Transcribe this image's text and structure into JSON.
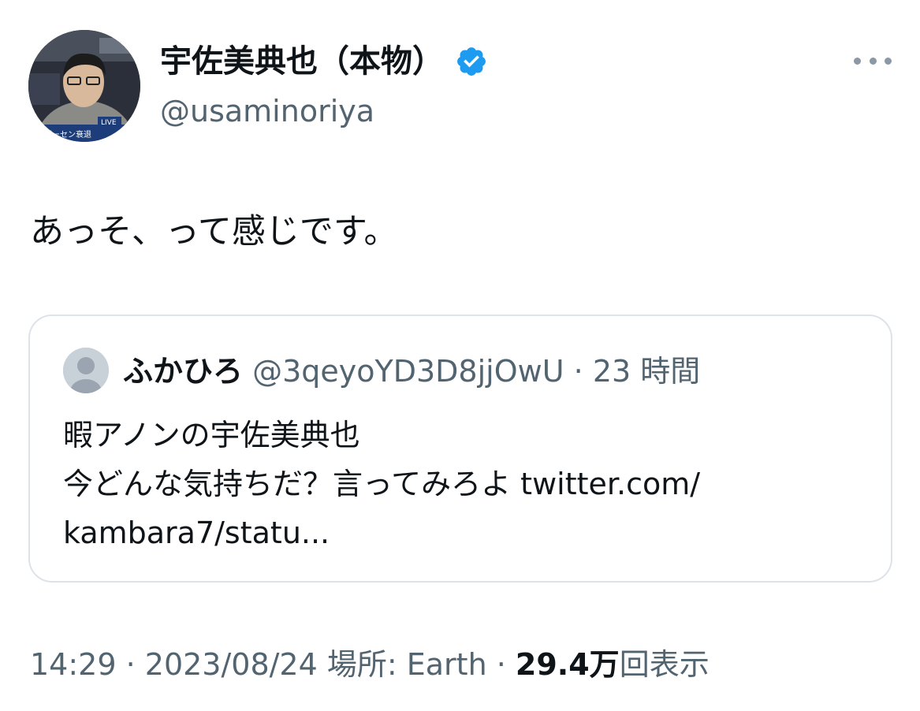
{
  "author": {
    "display_name": "宇佐美典也（本物）",
    "handle": "@usaminoriya",
    "verified_icon": "verified-badge-icon",
    "avatar_overlay_text": "LIVE"
  },
  "tweet": {
    "text": "あっそ、って感じです。"
  },
  "quoted_tweet": {
    "display_name": "ふかひろ",
    "handle": "@3qeyoYD3D8jjOwU",
    "separator": "·",
    "time": "23 時間",
    "lines": [
      "暇アノンの宇佐美典也",
      "今どんな気持ちだ？言ってみろよ twitter.com/",
      "kambara7/statu..."
    ]
  },
  "meta": {
    "time": "14:29",
    "separator1": " · ",
    "date": "2023/08/24",
    "location_label": " 場所: Earth",
    "separator2": " · ",
    "views_count": "29.4万",
    "views_label": "回表示"
  },
  "colors": {
    "text_primary": "#0f1419",
    "text_secondary": "#536471",
    "verified_blue": "#1d9bf0",
    "card_border": "#dde3e8"
  }
}
